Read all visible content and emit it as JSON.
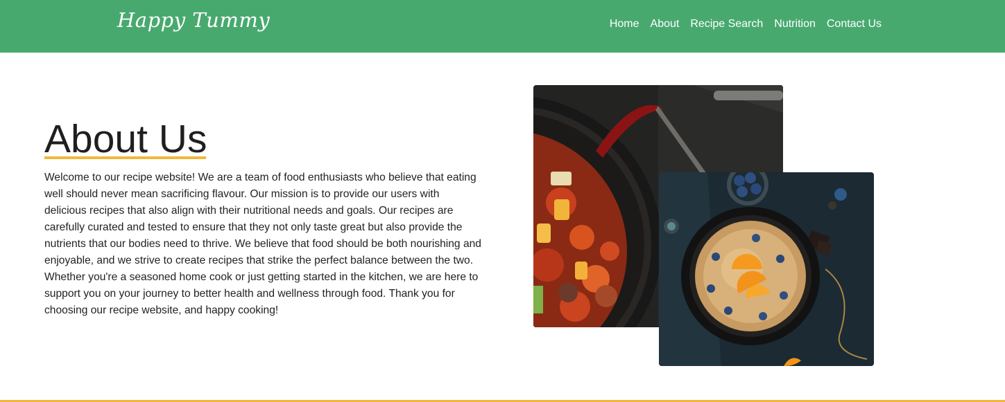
{
  "header": {
    "logo": "Happy Tummy",
    "nav": [
      "Home",
      "About",
      "Recipe Search",
      "Nutrition",
      "Contact Us"
    ],
    "background_color": "#48a96f"
  },
  "about": {
    "title": "About Us",
    "body": "Welcome to our recipe website! We are a team of food enthusiasts who believe that eating well should never mean sacrificing flavour. Our mission is to provide our users with delicious recipes that also align with their nutritional needs and goals. Our recipes are carefully curated and tested to ensure that they not only taste great but also provide the nutrients that our bodies need to thrive. We believe that food should be both nourishing and enjoyable, and we strive to create recipes that strike the perfect balance between the two. Whether you're a seasoned home cook or just getting started in the kitchen, we are here to support you on your journey to better health and wellness through food. Thank you for choosing our recipe website, and happy cooking!"
  },
  "accent_color": "#f2b63c"
}
